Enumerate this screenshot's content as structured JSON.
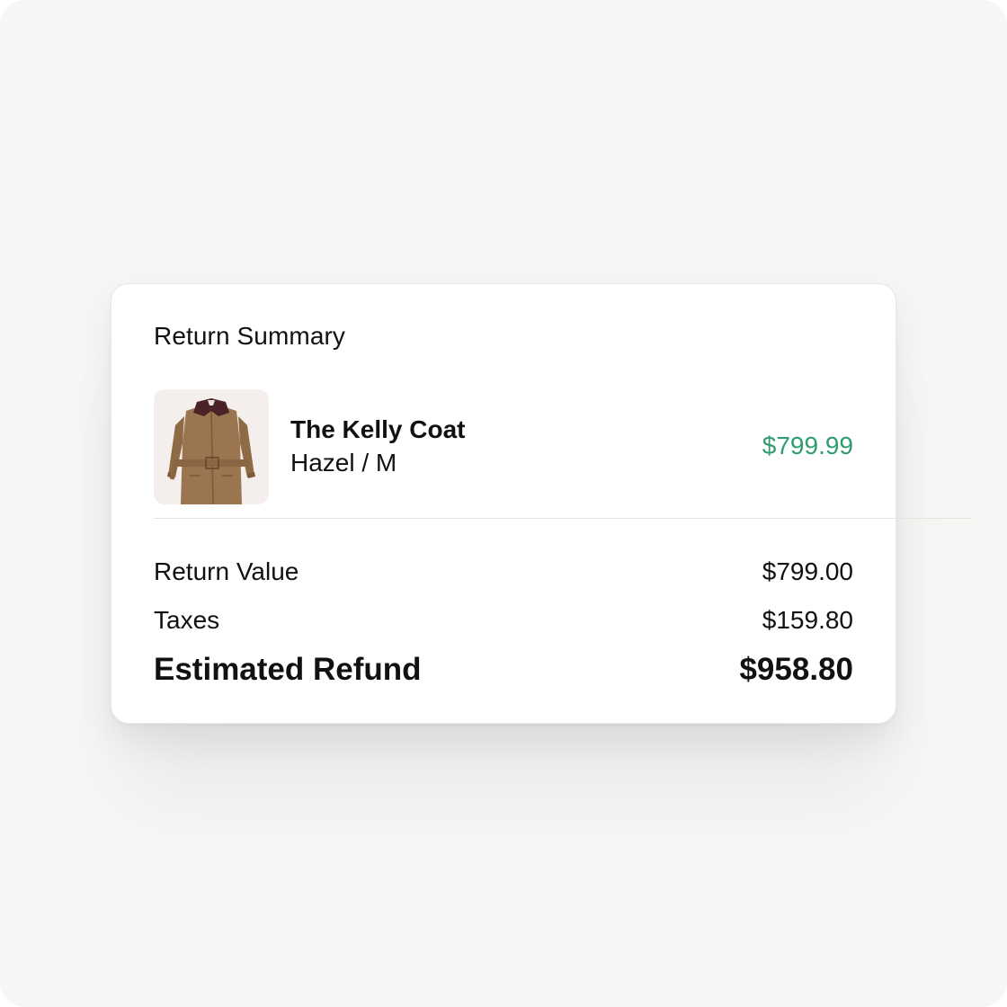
{
  "return_summary": {
    "title": "Return Summary",
    "item": {
      "image": "coat-image",
      "name": "The Kelly Coat",
      "variant": "Hazel / M",
      "price": "$799.99",
      "price_color": "#2e9c70"
    },
    "lines": {
      "return_value": {
        "label": "Return Value",
        "value": "$799.00"
      },
      "taxes": {
        "label": "Taxes",
        "value": "$159.80"
      },
      "estimated_refund": {
        "label": "Estimated Refund",
        "value": "$958.80"
      }
    }
  }
}
